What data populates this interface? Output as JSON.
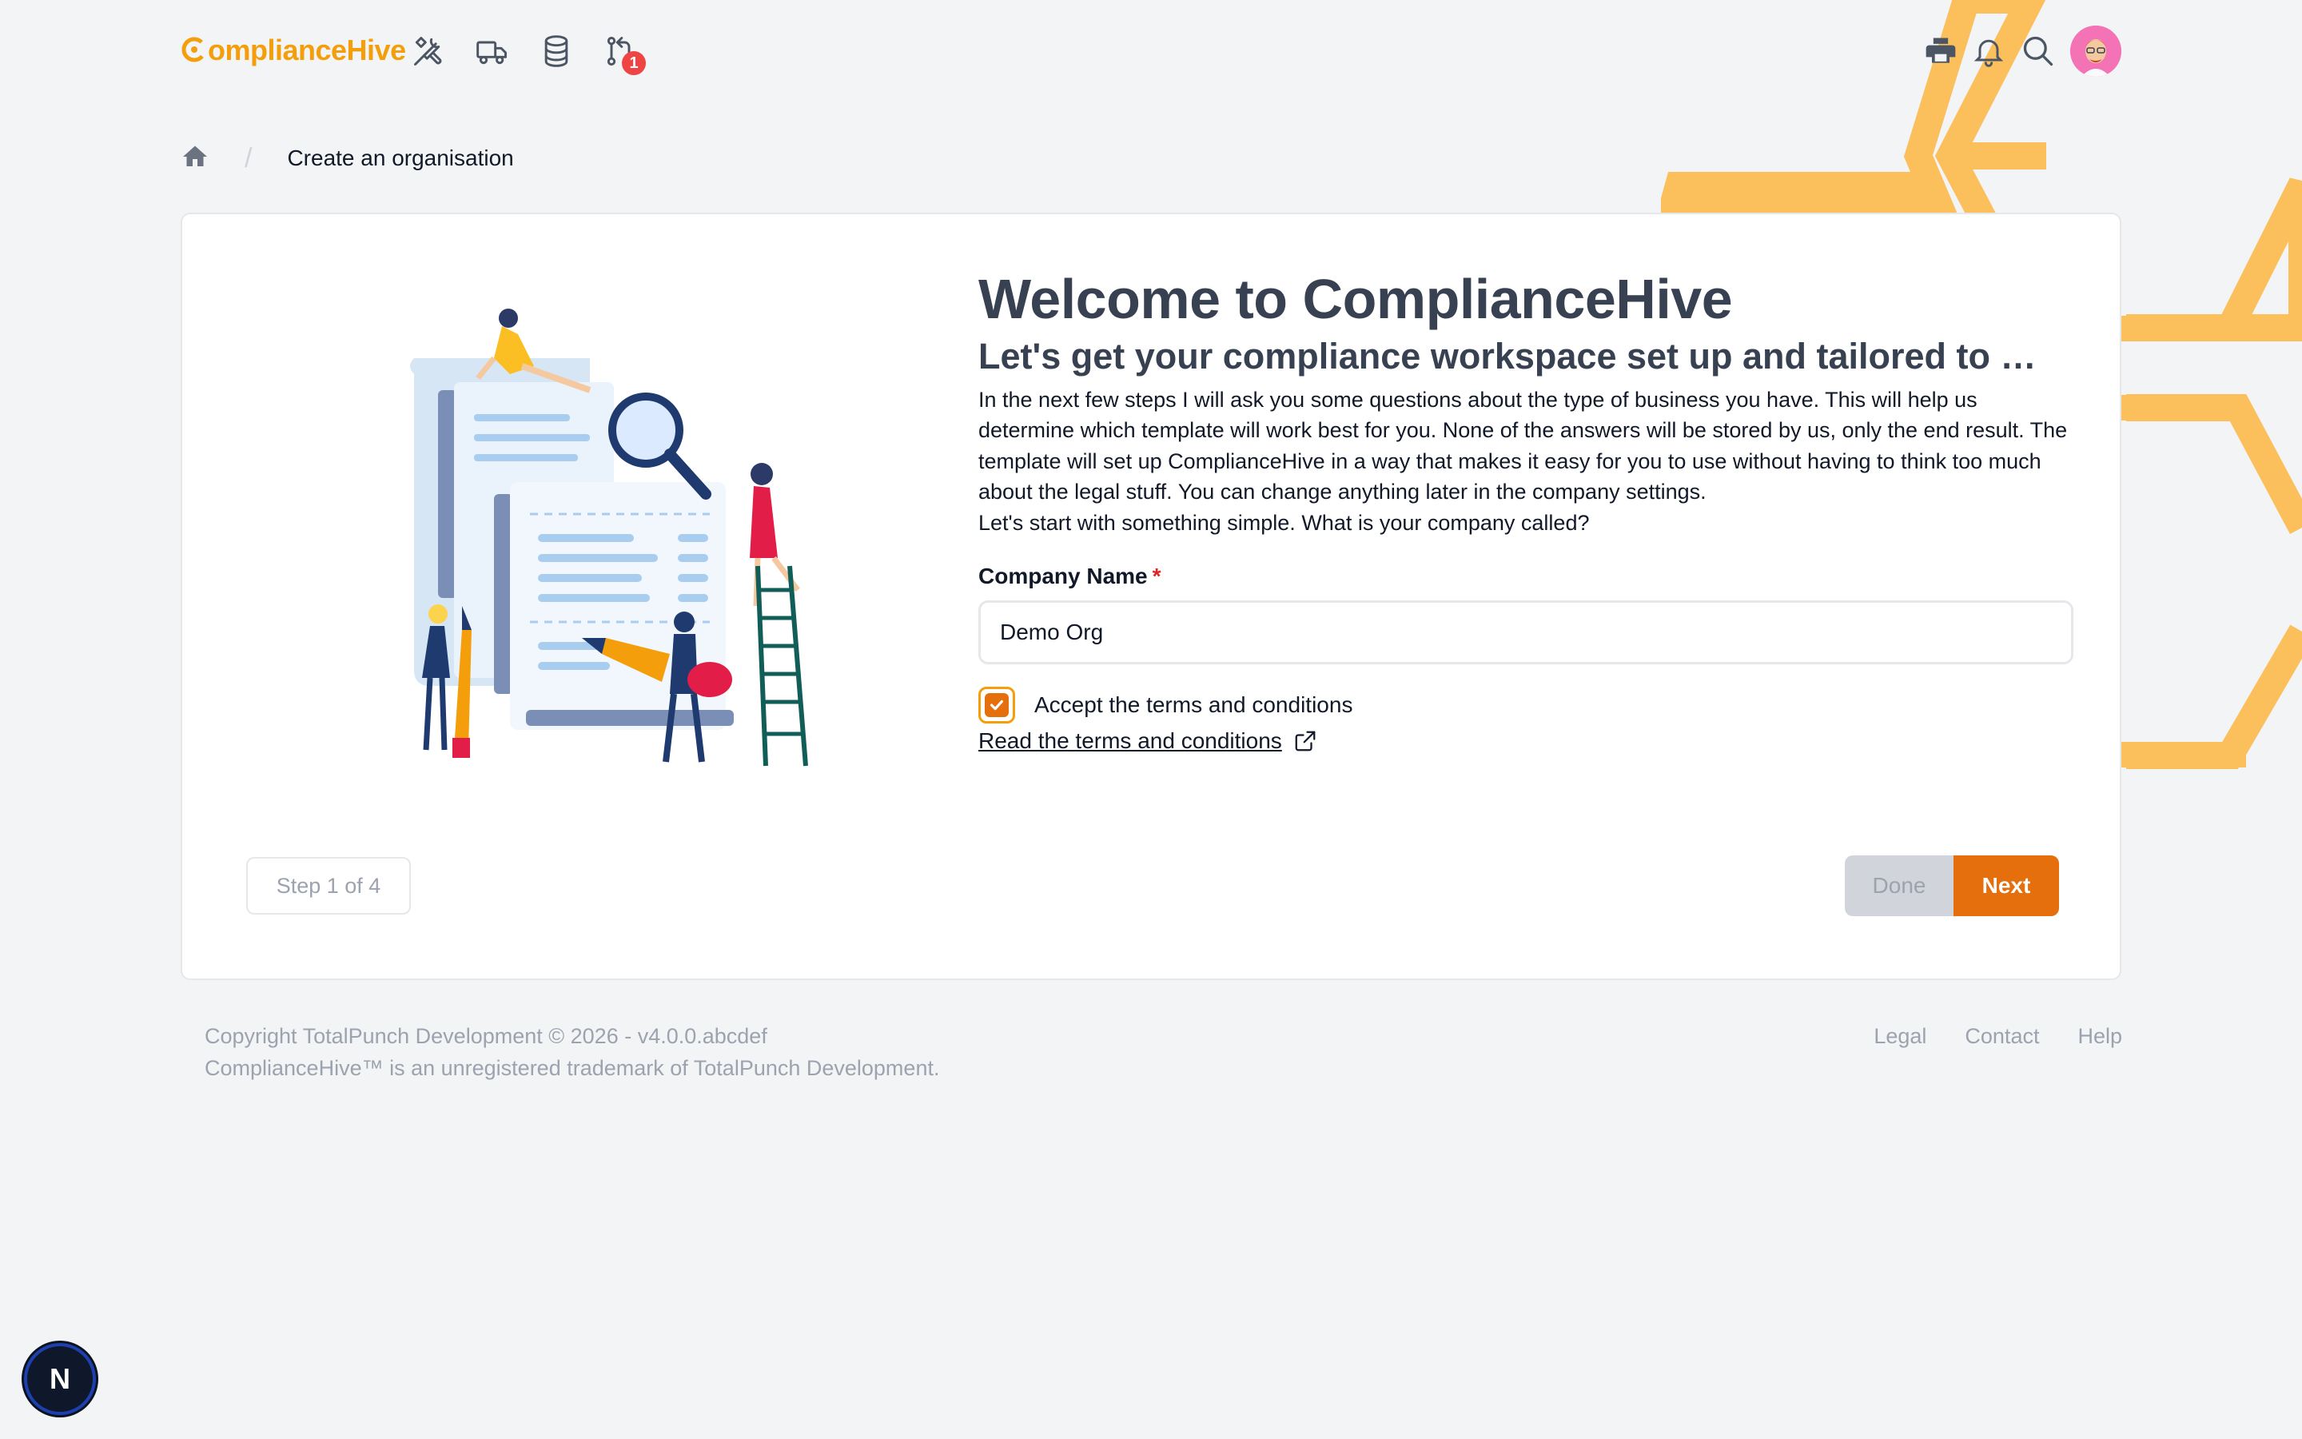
{
  "app": {
    "logo_text": "ComplianceHive",
    "logo_rest": "omplianceHive",
    "accent_color": "#e56f0c",
    "brand_color": "#f59e0b"
  },
  "nav": {
    "icons": [
      "tools-icon",
      "truck-icon",
      "database-icon",
      "git-pull-request-icon"
    ],
    "notification_badge": "1",
    "right_icons": [
      "printer-icon",
      "bell-icon",
      "search-icon",
      "avatar"
    ]
  },
  "breadcrumb": {
    "home_icon": "home-icon",
    "separator": "/",
    "current": "Create an organisation"
  },
  "wizard": {
    "title": "Welcome to ComplianceHive",
    "subtitle": "Let's get your compliance workspace set up and tailored to …",
    "intro": "In the next few steps I will ask you some questions about the type of business you have. This will help us determine which template will work best for you. None of the answers will be stored by us, only the end result. The template will set up ComplianceHive in a way that makes it easy for you to use without having to think too much about the legal stuff. You can change anything later in the company settings.",
    "prompt": "Let's start with something simple. What is your company called?",
    "company_label": "Company Name",
    "required_mark": "*",
    "company_value": "Demo Org",
    "accept_label": "Accept the terms and conditions",
    "accept_checked": true,
    "terms_link": "Read the terms and conditions",
    "step_label": "Step 1 of 4",
    "done_label": "Done",
    "next_label": "Next"
  },
  "footer": {
    "copyright": "Copyright TotalPunch Development © 2026 - v4.0.0.abcdef",
    "trademark": "ComplianceHive™ is an unregistered trademark of TotalPunch Development.",
    "links": [
      "Legal",
      "Contact",
      "Help"
    ]
  },
  "dev_indicator": {
    "label": "N"
  }
}
